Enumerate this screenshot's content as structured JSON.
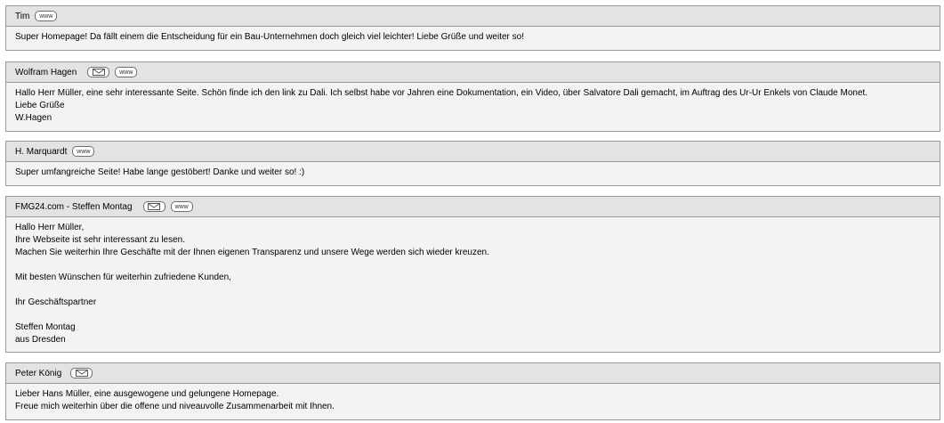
{
  "entries": [
    {
      "name": "Tim",
      "www_label": "www",
      "message": "Super Homepage! Da fällt einem die Entscheidung für ein Bau-Unternehmen doch gleich viel leichter! Liebe Grüße und weiter so!"
    },
    {
      "name": "Wolfram Hagen",
      "www_label": "www",
      "message": "Hallo Herr Müller, eine sehr interessante Seite. Schön finde ich den link zu Dali. Ich selbst habe vor Jahren eine Dokumentation, ein Video, über Salvatore Dali gemacht, im Auftrag des Ur-Ur Enkels von Claude Monet.\nLiebe Grüße\nW.Hagen"
    },
    {
      "name": "H. Marquardt",
      "www_label": "www",
      "message": "Super umfangreiche Seite! Habe lange gestöbert! Danke und weiter so! :)"
    },
    {
      "name": "FMG24.com - Steffen Montag",
      "www_label": "www",
      "message": "Hallo Herr Müller,\nIhre Webseite ist sehr interessant zu lesen.\nMachen Sie weiterhin Ihre Geschäfte mit der Ihnen eigenen Transparenz und unsere Wege werden sich wieder kreuzen.\n\nMit besten Wünschen für weiterhin zufriedene Kunden,\n\nIhr Geschäftspartner\n\nSteffen Montag\naus Dresden"
    },
    {
      "name": "Peter König",
      "message": "Lieber Hans Müller, eine ausgewogene und gelungene Homepage.\nFreue mich weiterhin über die offene und niveauvolle Zusammenarbeit mit Ihnen."
    }
  ]
}
